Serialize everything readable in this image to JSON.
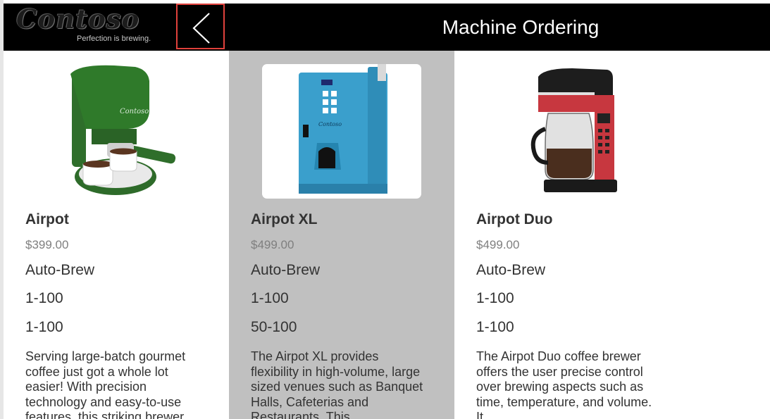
{
  "header": {
    "logo_text": "Contoso",
    "logo_tagline": "Perfection is brewing.",
    "back_icon": "chevron-left-icon",
    "title": "Machine Ordering"
  },
  "colors": {
    "header_bg": "#000000",
    "selected_card_bg": "#c0c0c0",
    "back_button_border": "#e0413c"
  },
  "products": [
    {
      "name": "Airpot",
      "price": "$399.00",
      "brew_type": "Auto-Brew",
      "range_a": "1-100",
      "range_b": "1-100",
      "description": "Serving large-batch gourmet coffee just got a whole lot easier! With precision technology and easy-to-use features, this striking brewer",
      "image": "green-espresso-machine-image",
      "selected": false
    },
    {
      "name": "Airpot XL",
      "price": "$499.00",
      "brew_type": "Auto-Brew",
      "range_a": "1-100",
      "range_b": "50-100",
      "description": "The Airpot XL provides flexibility in high-volume, large sized venues such as Banquet Halls, Cafeterias and Restaurants. This",
      "image": "blue-coffee-dispenser-image",
      "selected": true
    },
    {
      "name": "Airpot Duo",
      "price": "$499.00",
      "brew_type": "Auto-Brew",
      "range_a": "1-100",
      "range_b": "1-100",
      "description": "The Airpot Duo coffee brewer offers the user precise control over brewing aspects such as time, temperature, and volume. It",
      "image": "red-drip-coffee-maker-image",
      "selected": false
    }
  ]
}
